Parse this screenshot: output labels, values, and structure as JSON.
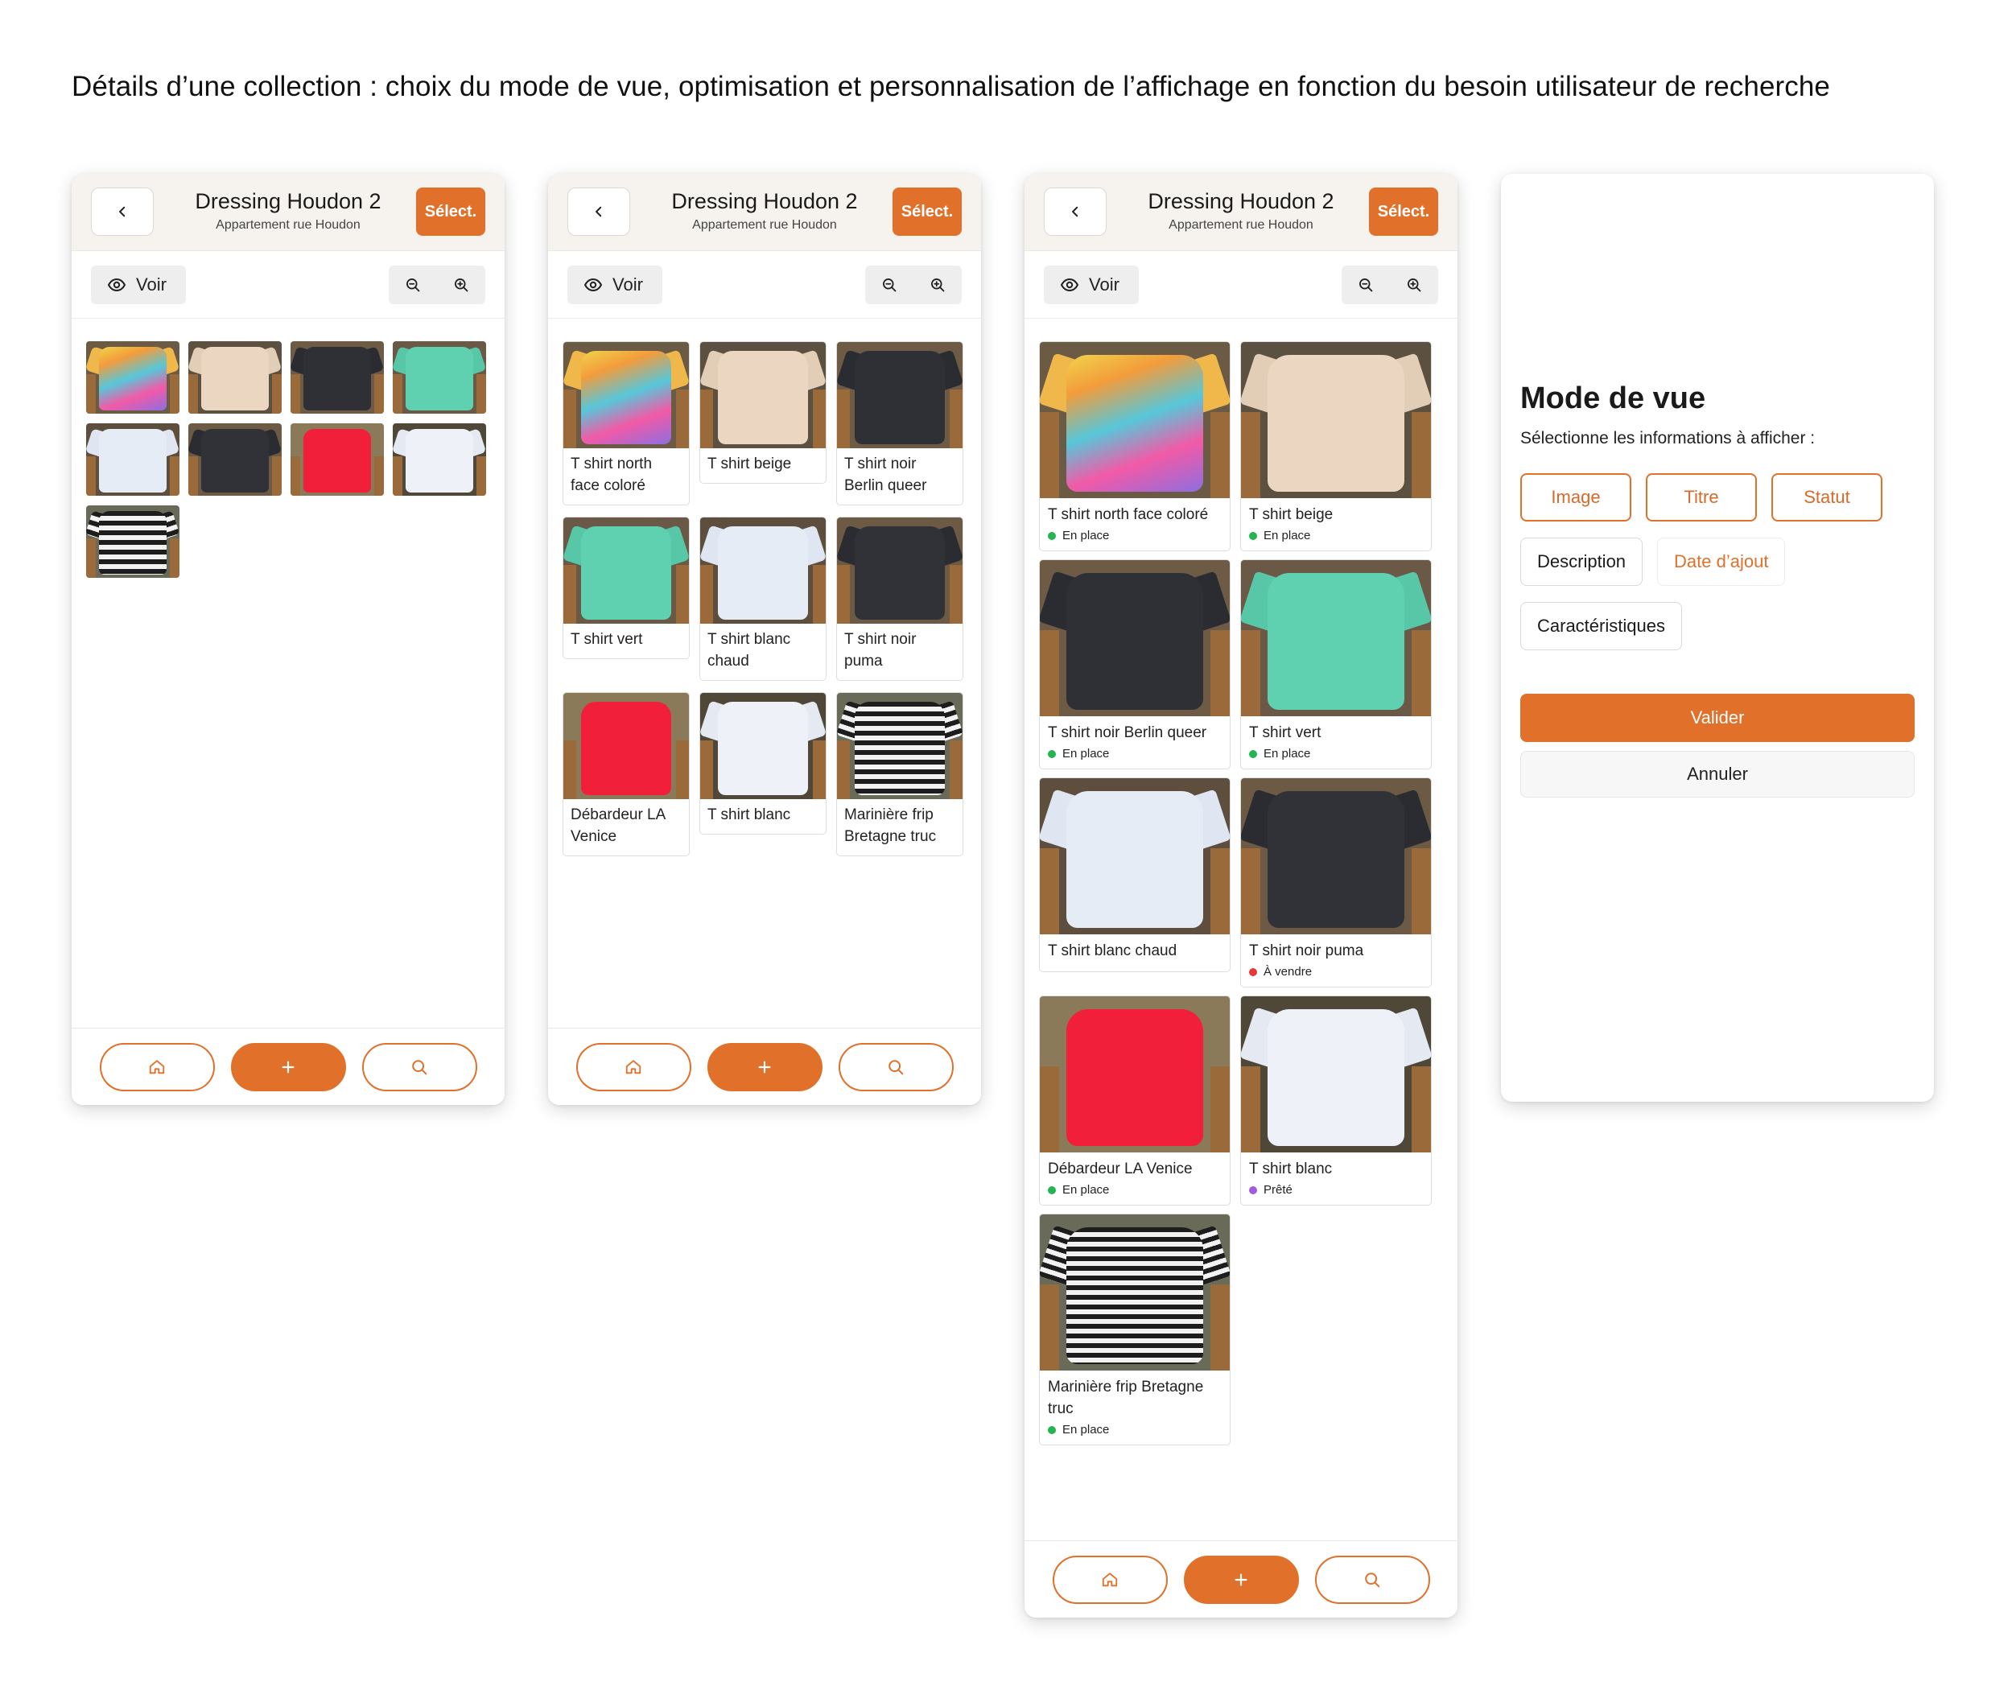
{
  "page_caption": "Détails d’une collection : choix du mode de vue, optimisation et personnalisation de l’affichage en fonction du besoin utilisateur de recherche",
  "header": {
    "title": "Dressing Houdon 2",
    "subtitle": "Appartement rue Houdon",
    "select_label": "Sélect."
  },
  "toolbar": {
    "view_label": "Voir"
  },
  "colors": {
    "accent": "#e0702a",
    "status_en_place": "#22b552",
    "status_a_vendre": "#e5383b",
    "status_prete": "#a25be0"
  },
  "items": [
    {
      "title": "T shirt north face coloré",
      "status": "En place",
      "status_key": "en_place",
      "shirt": "tie-dye"
    },
    {
      "title": "T shirt beige",
      "status": "En place",
      "status_key": "en_place",
      "shirt": "beige"
    },
    {
      "title": "T shirt noir Berlin queer",
      "status": "En place",
      "status_key": "en_place",
      "shirt": "black"
    },
    {
      "title": "T shirt vert",
      "status": "En place",
      "status_key": "en_place",
      "shirt": "mint"
    },
    {
      "title": "T shirt blanc chaud",
      "status": "",
      "status_key": "",
      "shirt": "white"
    },
    {
      "title": "T shirt noir puma",
      "status": "À vendre",
      "status_key": "a_vendre",
      "shirt": "black-puma"
    },
    {
      "title": "Débardeur LA Venice",
      "status": "En place",
      "status_key": "en_place",
      "shirt": "red"
    },
    {
      "title": "T shirt blanc",
      "status": "Prêté",
      "status_key": "prete",
      "shirt": "white2"
    },
    {
      "title": "Marinière frip Bretagne truc",
      "status": "En place",
      "status_key": "en_place",
      "shirt": "stripes"
    }
  ],
  "mode_panel": {
    "title": "Mode de vue",
    "subtitle": "Sélectionne les informations à afficher :",
    "options": [
      {
        "label": "Image",
        "state": "on"
      },
      {
        "label": "Titre",
        "state": "on"
      },
      {
        "label": "Statut",
        "state": "on"
      },
      {
        "label": "Description",
        "state": "off"
      },
      {
        "label": "Date d’ajout",
        "state": "soft"
      },
      {
        "label": "Caractéristiques",
        "state": "off"
      }
    ],
    "validate_label": "Valider",
    "cancel_label": "Annuler"
  },
  "icons": {
    "back": "chevron-left-icon",
    "view": "eye-icon",
    "zoom_out": "zoom-out-icon",
    "zoom_in": "zoom-in-icon",
    "home": "home-icon",
    "add": "plus-icon",
    "search": "search-icon"
  }
}
